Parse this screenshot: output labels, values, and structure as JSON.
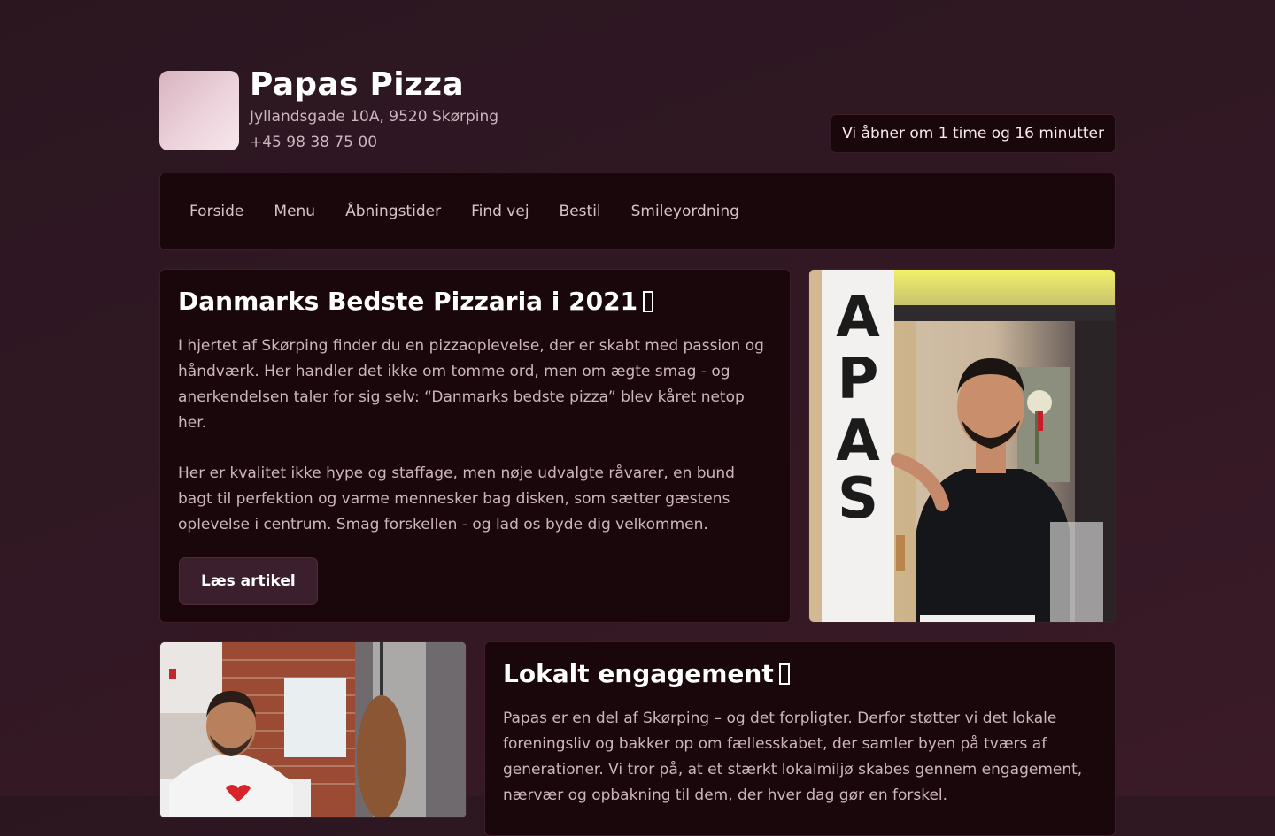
{
  "header": {
    "title": "Papas Pizza",
    "address": "Jyllandsgade 10A, 9520 Skørping",
    "phone": "+45 98 38 75 00",
    "status": "Vi åbner om 1 time og 16 minutter"
  },
  "nav": {
    "items": [
      {
        "label": "Forside"
      },
      {
        "label": "Menu"
      },
      {
        "label": "Åbningstider"
      },
      {
        "label": "Find vej"
      },
      {
        "label": "Bestil"
      },
      {
        "label": "Smileyordning"
      }
    ]
  },
  "article1": {
    "title": "Danmarks Bedste Pizzaria i 2021",
    "paragraph1": "I hjertet af Skørping finder du en pizzaoplevelse, der er skabt med passion og håndværk. Her handler det ikke om tomme ord, men om ægte smag - og anerkendelsen taler for sig selv: “Danmarks bedste pizza” blev kåret netop her.",
    "paragraph2": "Her er kvalitet ikke hype og staffage, men nøje udvalgte råvarer, en bund bagt til perfektion og varme mennesker bag disken, som sætter gæstens oplevelse i centrum. Smag forskellen - og lad os byde dig velkommen.",
    "button": "Læs artikel"
  },
  "article2": {
    "title": "Lokalt engagement",
    "paragraph1": "Papas er en del af Skørping – og det forpligter. Derfor støtter vi det lokale foreningsliv og bakker op om fællesskabet, der samler byen på tværs af generationer. Vi tror på, at et stærkt lokalmiljø skabes gennem engagement, nærvær og opbakning til dem, der hver dag gør en forskel."
  },
  "photo1": {
    "sign_text": "PAPAS"
  },
  "colors": {
    "background": "#2b1620",
    "card": "#1a070c",
    "button": "#3c1f2c"
  }
}
